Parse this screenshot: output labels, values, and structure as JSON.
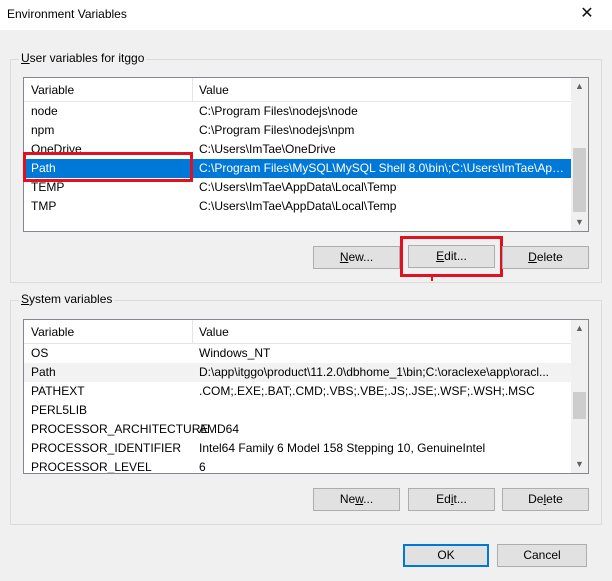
{
  "window": {
    "title": "Environment Variables",
    "close_glyph": "✕"
  },
  "user_group": {
    "legend_prefix": "U",
    "legend_rest": "ser variables for itggo",
    "columns": [
      "Variable",
      "Value"
    ],
    "rows": [
      {
        "variable": "node",
        "value": "C:\\Program Files\\nodejs\\node"
      },
      {
        "variable": "npm",
        "value": "C:\\Program Files\\nodejs\\npm"
      },
      {
        "variable": "OneDrive",
        "value": "C:\\Users\\ImTae\\OneDrive"
      },
      {
        "variable": "Path",
        "value": "C:\\Program Files\\MySQL\\MySQL Shell 8.0\\bin\\;C:\\Users\\ImTae\\App..."
      },
      {
        "variable": "TEMP",
        "value": "C:\\Users\\ImTae\\AppData\\Local\\Temp"
      },
      {
        "variable": "TMP",
        "value": "C:\\Users\\ImTae\\AppData\\Local\\Temp"
      }
    ],
    "selected_variable": "Path",
    "buttons": {
      "new_u": "N",
      "new_rest": "ew...",
      "edit_u": "E",
      "edit_rest": "dit...",
      "delete_u": "D",
      "delete_rest": "elete"
    }
  },
  "system_group": {
    "legend_prefix": "S",
    "legend_rest": "ystem variables",
    "columns": [
      "Variable",
      "Value"
    ],
    "rows": [
      {
        "variable": "OS",
        "value": "Windows_NT"
      },
      {
        "variable": "Path",
        "value": "D:\\app\\itggo\\product\\11.2.0\\dbhome_1\\bin;C:\\oraclexe\\app\\oracl..."
      },
      {
        "variable": "PATHEXT",
        "value": ".COM;.EXE;.BAT;.CMD;.VBS;.VBE;.JS;.JSE;.WSF;.WSH;.MSC"
      },
      {
        "variable": "PERL5LIB",
        "value": ""
      },
      {
        "variable": "PROCESSOR_ARCHITECTURE",
        "value": "AMD64"
      },
      {
        "variable": "PROCESSOR_IDENTIFIER",
        "value": "Intel64 Family 6 Model 158 Stepping 10, GenuineIntel"
      },
      {
        "variable": "PROCESSOR_LEVEL",
        "value": "6"
      }
    ],
    "buttons": {
      "new_pre": "Ne",
      "new_u": "w",
      "new_rest": "...",
      "edit_pre": "Ed",
      "edit_u": "i",
      "edit_rest": "t...",
      "delete_pre": "De",
      "delete_u": "l",
      "delete_rest": "ete"
    }
  },
  "footer": {
    "ok_label": "OK",
    "cancel_label": "Cancel"
  },
  "colors": {
    "selection": "#0078d7",
    "annotation_red": "#e0121f"
  }
}
